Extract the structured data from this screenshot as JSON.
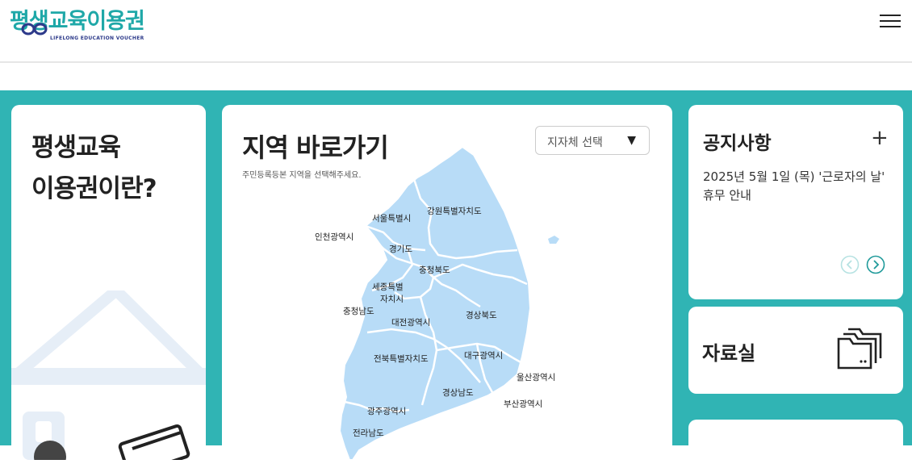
{
  "header": {
    "logo_text": "평생교육이용권",
    "logo_subtext": "LIFELONG EDUCATION VOUCHER",
    "menu_icon": "hamburger-menu-icon"
  },
  "about": {
    "title_line1": "평생교육",
    "title_line2": "이용권이란?"
  },
  "region": {
    "title": "지역 바로가기",
    "subtitle": "주민등록등본 지역을 선택해주세요.",
    "select_label": "지자체 선택",
    "labels": {
      "seoul": "서울특별시",
      "gangwon": "강원특별자치도",
      "incheon": "인천광역시",
      "gyeonggi": "경기도",
      "chungbuk": "충청북도",
      "sejong_1": "세종특별",
      "sejong_2": "자치시",
      "chungnam": "충청남도",
      "daejeon": "대전광역시",
      "gyeongbuk": "경상북도",
      "jeonbuk": "전북특별자치도",
      "daegu": "대구광역시",
      "ulsan": "울산광역시",
      "gyeongnam": "경상남도",
      "busan": "부산광역시",
      "gwangju": "광주광역시",
      "jeonnam": "전라남도"
    }
  },
  "notice": {
    "title": "공지사항",
    "more_label": "+",
    "item_text": "2025년 5월 1일 (목) '근로자의 날' 휴무 안내"
  },
  "archive": {
    "title": "자료실",
    "icon": "folder-icon"
  },
  "colors": {
    "brand_teal": "#30b4b4",
    "map_fill": "#b8dcf7"
  }
}
